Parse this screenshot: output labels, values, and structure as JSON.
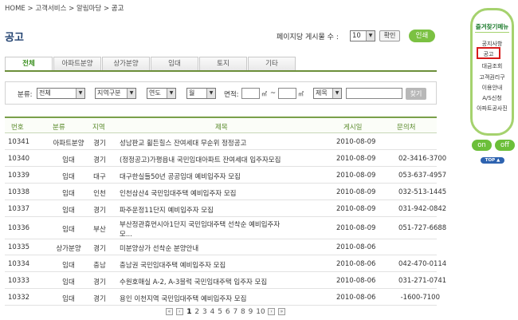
{
  "breadcrumb": {
    "home": "HOME",
    "sep": ">",
    "level1": "고객서비스",
    "level2": "알림마당",
    "current": "공고"
  },
  "page_title": "공고",
  "toolbar": {
    "per_page_label": "페이지당 게시물 수 :",
    "per_page_value": "10",
    "confirm_label": "확인",
    "print_label": "인쇄"
  },
  "tabs": [
    {
      "label": "전체",
      "active": true
    },
    {
      "label": "아파트분양",
      "active": false
    },
    {
      "label": "상가분양",
      "active": false
    },
    {
      "label": "임대",
      "active": false
    },
    {
      "label": "토지",
      "active": false
    },
    {
      "label": "기타",
      "active": false
    }
  ],
  "search": {
    "category_label": "분류:",
    "category_value": "전체",
    "region_value": "지역구분",
    "year_value": "연도",
    "month_value": "월",
    "area_label": "면적:",
    "area_unit": "㎡",
    "area_tilde": "~",
    "field_value": "제목",
    "search_label": "찾기"
  },
  "table": {
    "headers": [
      "번호",
      "분류",
      "지역",
      "제목",
      "게시일",
      "문의처"
    ],
    "rows": [
      {
        "no": "10341",
        "category": "아파트분양",
        "region": "경기",
        "title": "성남판교 휠든힐스 잔여세대 무순위 정정공고",
        "date": "2010-08-09",
        "contact": ""
      },
      {
        "no": "10340",
        "category": "임대",
        "region": "경기",
        "title": "(정정공고)가평읍내 국민임대아파트 잔여세대 입주자모집",
        "date": "2010-08-09",
        "contact": "02-3416-3700"
      },
      {
        "no": "10339",
        "category": "임대",
        "region": "대구",
        "title": "대구한실들50년 공공임대 예비입주자 모집",
        "date": "2010-08-09",
        "contact": "053-637-4957"
      },
      {
        "no": "10338",
        "category": "임대",
        "region": "인천",
        "title": "인천삼산4 국민임대주택 예비입주자 모집",
        "date": "2010-08-09",
        "contact": "032-513-1445"
      },
      {
        "no": "10337",
        "category": "임대",
        "region": "경기",
        "title": "파주운정11단지 예비입주자 모집",
        "date": "2010-08-09",
        "contact": "031-942-0842"
      },
      {
        "no": "10336",
        "category": "임대",
        "region": "부산",
        "title": "부산정관휴먼시아1단지 국민임대주택 선착순 예비입주자 모...",
        "title_line1": "부산정관휴먼시아1단지 국민임대주택 선착순 예비입주자",
        "title_line2": "모...",
        "date": "2010-08-09",
        "contact": "051-727-6688"
      },
      {
        "no": "10335",
        "category": "상가분양",
        "region": "경기",
        "title": "미분양상가 선착순 분양안내",
        "date": "2010-08-06",
        "contact": ""
      },
      {
        "no": "10334",
        "category": "임대",
        "region": "충남",
        "title": "충남권 국민임대주택 예비입주자 모집",
        "date": "2010-08-06",
        "contact": "042-470-0114"
      },
      {
        "no": "10333",
        "category": "임대",
        "region": "경기",
        "title": "수원호매실 A-2, A-3블럭 국민임대주택 입주자 모집",
        "date": "2010-08-06",
        "contact": "031-271-0741"
      },
      {
        "no": "10332",
        "category": "임대",
        "region": "경기",
        "title": "용인 이천지역 국민임대주택 예비입주자 모집",
        "date": "2010-08-06",
        "contact": "-1600-7100"
      }
    ]
  },
  "pagination": {
    "first": "«",
    "prev": "‹",
    "next": "›",
    "last": "»",
    "pages": [
      "1",
      "2",
      "3",
      "4",
      "5",
      "6",
      "7",
      "8",
      "9",
      "10"
    ],
    "current": "1"
  },
  "quick_menu": {
    "title": "즐겨찾기메뉴",
    "items": [
      "공지사항",
      "공고",
      "대금조회",
      "고객권리구",
      "이용안내",
      "A/S신청",
      "아파트공사진"
    ],
    "selected": "공고",
    "on_label": "on",
    "off_label": "off",
    "top_label": "TOP"
  },
  "colors": {
    "brand_green": "#7bc142",
    "title_blue": "#1e3f6e",
    "header_green": "#5a8a2b",
    "highlight_red": "#d61c1c",
    "top_blue": "#2e63b0"
  }
}
